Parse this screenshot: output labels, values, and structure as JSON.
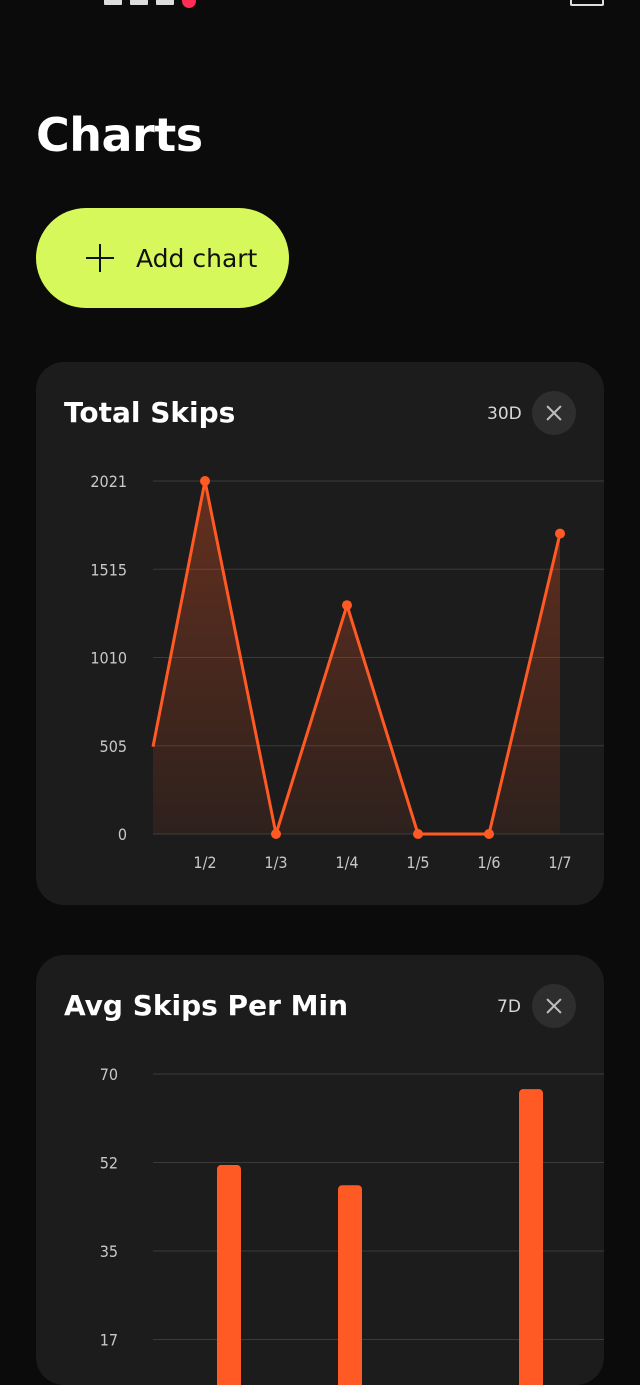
{
  "page": {
    "title": "Charts",
    "add_button_label": "Add chart"
  },
  "colors": {
    "accent": "#d7f85a",
    "series": "#ff5a24",
    "card_bg": "#1c1c1c",
    "page_bg": "#0b0b0b"
  },
  "icons": {
    "add": "plus-icon",
    "close": "close-icon"
  },
  "cards": [
    {
      "title": "Total Skips",
      "range": "30D"
    },
    {
      "title": "Avg Skips Per Min",
      "range": "7D"
    }
  ],
  "chart_data": [
    {
      "type": "area",
      "title": "Total Skips",
      "x": [
        "1/2",
        "1/3",
        "1/4",
        "1/5",
        "1/6",
        "1/7"
      ],
      "y_ticks": [
        "2021",
        "1515",
        "1010",
        "505",
        "0"
      ],
      "ylim": [
        0,
        2021
      ],
      "left_partial_value": 500,
      "values": [
        2021,
        0,
        1310,
        0,
        0,
        1720
      ],
      "grid": true,
      "color": "#ff5a24"
    },
    {
      "type": "bar",
      "title": "Avg Skips Per Min",
      "y_ticks": [
        "70",
        "52",
        "35",
        "17"
      ],
      "ylim": [
        0,
        70
      ],
      "values": [
        52,
        48,
        0,
        67
      ],
      "grid": true,
      "color": "#ff5a24"
    }
  ]
}
